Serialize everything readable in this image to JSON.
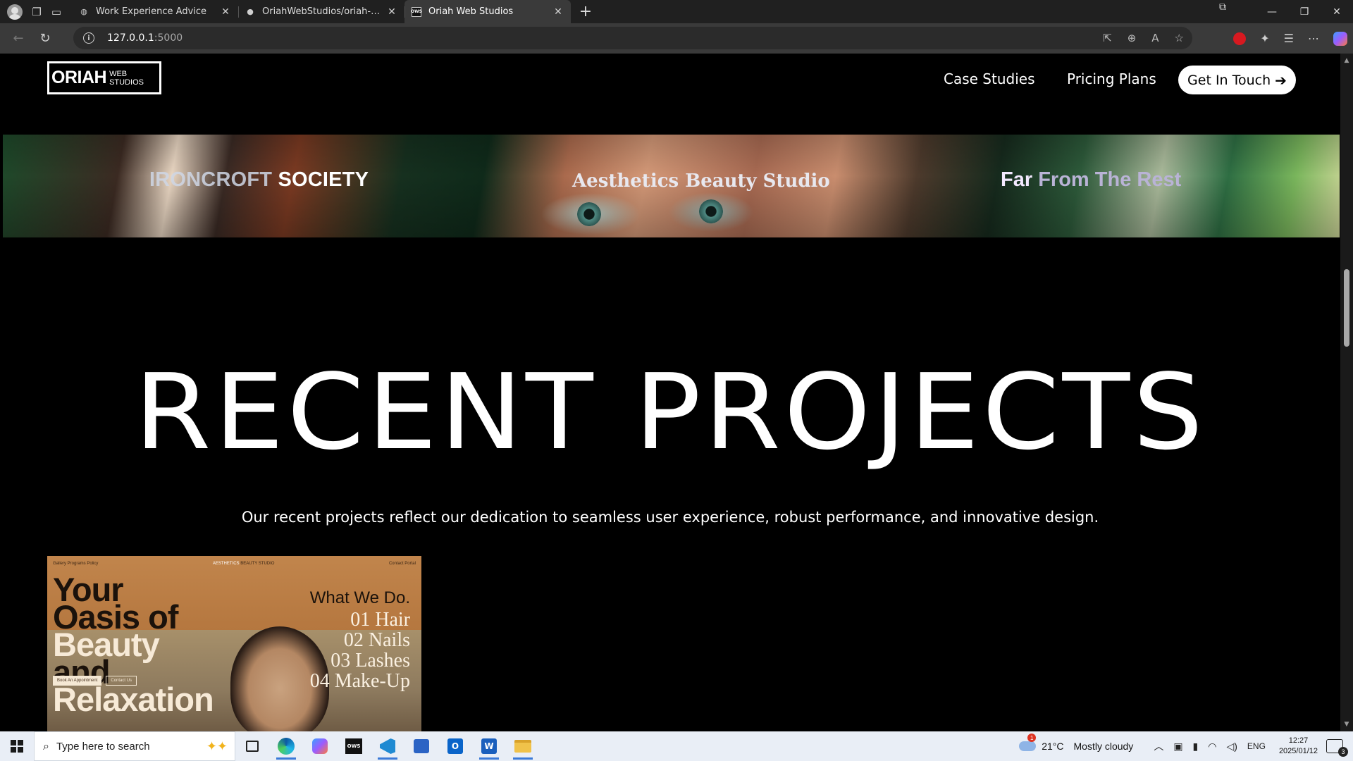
{
  "browser": {
    "tabs": [
      {
        "title": "Work Experience Advice",
        "active": false
      },
      {
        "title": "OriahWebStudios/oriah-web-stud",
        "active": false
      },
      {
        "title": "Oriah Web Studios",
        "active": true
      }
    ],
    "url_host": "127.0.0.1",
    "url_port": ":5000"
  },
  "site": {
    "logo_main": "ORIAH",
    "logo_sub": "WEB STUDIOS",
    "nav": {
      "case_studies": "Case Studies",
      "pricing_plans": "Pricing Plans",
      "cta": "Get In Touch"
    },
    "hero_brands": {
      "ironcroft_a": "IRONCROFT",
      "ironcroft_b": "SOCIETY",
      "aesthetics": "Aesthetics Beauty Studio",
      "far_a": "Far",
      "far_b": "From The Rest"
    },
    "section_title": "RECENT PROJECTS",
    "section_subtitle": "Our recent projects reflect our dedication to seamless user experience, robust performance, and innovative design.",
    "project_card": {
      "nav_left": "Gallery  Programs  Policy",
      "nav_brand_a": "AESTHETICS",
      "nav_brand_b": " BEAUTY STUDIO",
      "nav_right": "Contact  Portal",
      "head_dark_1": "Your",
      "head_dark_2": "Oasis of",
      "head_light_1": "Beauty",
      "head_dark_3": "and",
      "head_light_2": "Relaxation",
      "what_title": "What We Do.",
      "services": [
        "01 Hair",
        "02 Nails",
        "03 Lashes",
        "04 Make-Up"
      ],
      "btn_book": "Book An Appointment",
      "btn_contact": "Contact Us"
    }
  },
  "taskbar": {
    "search_placeholder": "Type here to search",
    "weather_badge": "1",
    "weather_temp": "21°C",
    "weather_desc": "Mostly cloudy",
    "lang": "ENG",
    "time": "12:27",
    "date": "2025/01/12",
    "notif_count": "3"
  }
}
